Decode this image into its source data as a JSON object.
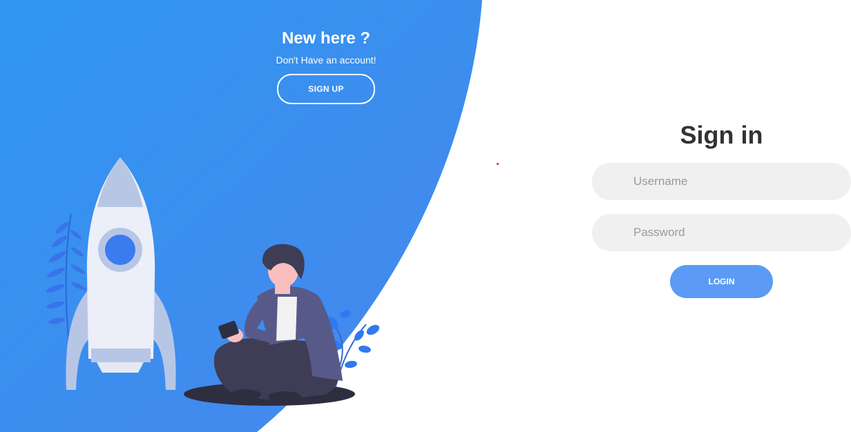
{
  "promo": {
    "title": "New here ?",
    "subtitle": "Don't Have an account!",
    "signup_label": "SIGN UP"
  },
  "signin": {
    "title": "Sign in",
    "username_placeholder": "Username",
    "password_placeholder": "Password",
    "login_label": "LOGIN"
  },
  "colors": {
    "panel_start": "#2f95f0",
    "panel_end": "#4a87ec",
    "login_button": "#5b9bf5",
    "input_background": "#f0f0f0"
  },
  "illustration": {
    "icons": [
      "rocket-illustration",
      "person-with-phone-illustration",
      "plant-illustration"
    ]
  }
}
